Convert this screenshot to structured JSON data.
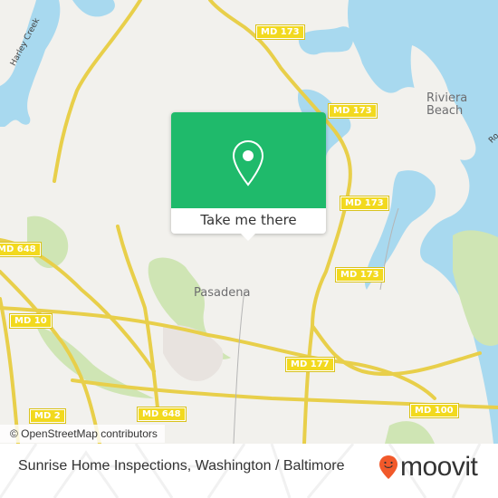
{
  "map": {
    "road_shields": [
      {
        "label": "MD 173",
        "name": "shield-md173-north"
      },
      {
        "label": "MD 173",
        "name": "shield-md173-center"
      },
      {
        "label": "MD 173",
        "name": "shield-md173-east"
      },
      {
        "label": "MD 173",
        "name": "shield-md173-south"
      },
      {
        "label": "MD 648",
        "name": "shield-md648-west"
      },
      {
        "label": "MD 10",
        "name": "shield-md10"
      },
      {
        "label": "MD 177",
        "name": "shield-md177"
      },
      {
        "label": "MD 2",
        "name": "shield-md2"
      },
      {
        "label": "MD 648",
        "name": "shield-md648-south"
      },
      {
        "label": "MD 100",
        "name": "shield-md100"
      }
    ],
    "places": {
      "riviera_line1": "Riviera",
      "riviera_line2": "Beach",
      "pasadena": "Pasadena"
    },
    "water_labels": {
      "harley_creek": "Harley Creek",
      "edge_label": "Ro"
    },
    "colors": {
      "land": "#f2f1ed",
      "water": "#a8d9ef",
      "park": "#cfe5b4",
      "road": "#f5e27a",
      "accent": "#1fba6b"
    }
  },
  "popup": {
    "icon": "map-pin-icon",
    "action_label": "Take me there"
  },
  "attribution": "© OpenStreetMap contributors",
  "footer": {
    "title": "Sunrise Home Inspections, Washington / Baltimore",
    "brand": "moovit",
    "brand_color": "#f1592a"
  }
}
